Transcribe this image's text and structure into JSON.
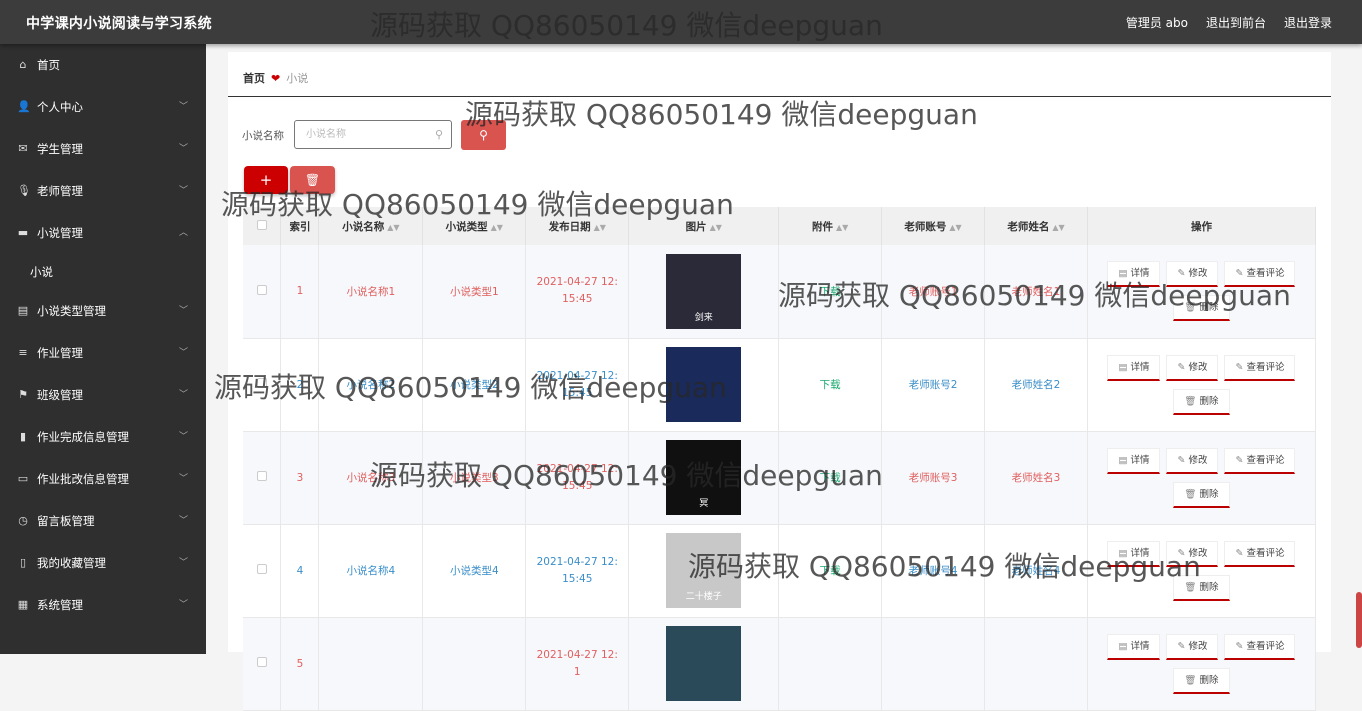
{
  "header": {
    "app_title": "中学课内小说阅读与学习系统",
    "admin_label": "管理员 abo",
    "exit_front": "退出到前台",
    "logout": "退出登录"
  },
  "sidebar": {
    "items": [
      {
        "label": "首页",
        "icon": "home-icon",
        "expandable": false
      },
      {
        "label": "个人中心",
        "icon": "user-icon",
        "expandable": true
      },
      {
        "label": "学生管理",
        "icon": "mail-icon",
        "expandable": true
      },
      {
        "label": "老师管理",
        "icon": "microphone-icon",
        "expandable": true
      },
      {
        "label": "小说管理",
        "icon": "book-icon",
        "expandable": true,
        "expanded": true
      },
      {
        "label": "小说类型管理",
        "icon": "clipboard-icon",
        "expandable": true
      },
      {
        "label": "作业管理",
        "icon": "list-icon",
        "expandable": true
      },
      {
        "label": "班级管理",
        "icon": "flag-icon",
        "expandable": true
      },
      {
        "label": "作业完成信息管理",
        "icon": "bar-chart-icon",
        "expandable": true
      },
      {
        "label": "作业批改信息管理",
        "icon": "monitor-icon",
        "expandable": true
      },
      {
        "label": "留言板管理",
        "icon": "compass-icon",
        "expandable": true
      },
      {
        "label": "我的收藏管理",
        "icon": "bottle-icon",
        "expandable": true
      },
      {
        "label": "系统管理",
        "icon": "grid-icon",
        "expandable": true
      }
    ],
    "subitem": "小说"
  },
  "breadcrumb": {
    "home": "首页",
    "current": "小说"
  },
  "search": {
    "label": "小说名称",
    "placeholder": "小说名称"
  },
  "table": {
    "headers": [
      "索引",
      "小说名称",
      "小说类型",
      "发布日期",
      "图片",
      "附件",
      "老师账号",
      "老师姓名",
      "操作"
    ],
    "rows": [
      {
        "index": "1",
        "name": "小说名称1",
        "type": "小说类型1",
        "date": "2021-04-27 12:15:45",
        "attachment": "下载",
        "account": "老师账号1",
        "teacher": "老师姓名1",
        "color": "red",
        "cover_color": "#2a2a38",
        "cover_text": "剑来"
      },
      {
        "index": "2",
        "name": "小说名称2",
        "type": "小说类型2",
        "date": "2021-04-27 12:15:45",
        "attachment": "下载",
        "account": "老师账号2",
        "teacher": "老师姓名2",
        "color": "blue",
        "cover_color": "#1a2a5a",
        "cover_text": ""
      },
      {
        "index": "3",
        "name": "小说名称3",
        "type": "小说类型3",
        "date": "2021-04-27 12:15:45",
        "attachment": "下载",
        "account": "老师账号3",
        "teacher": "老师姓名3",
        "color": "red",
        "cover_color": "#101010",
        "cover_text": "冥"
      },
      {
        "index": "4",
        "name": "小说名称4",
        "type": "小说类型4",
        "date": "2021-04-27 12:15:45",
        "attachment": "下载",
        "account": "老师账号4",
        "teacher": "老师姓名4",
        "color": "blue",
        "cover_color": "#c8c8c8",
        "cover_text": "二十楼子"
      },
      {
        "index": "5",
        "name": "",
        "type": "",
        "date": "2021-04-27 12:1",
        "attachment": "",
        "account": "",
        "teacher": "",
        "color": "red",
        "cover_color": "#2a4a5a",
        "cover_text": ""
      }
    ],
    "ops": {
      "detail": "详情",
      "edit": "修改",
      "comment": "查看评论",
      "delete": "删除"
    }
  },
  "watermark": "源码获取 QQ86050149 微信deepguan"
}
